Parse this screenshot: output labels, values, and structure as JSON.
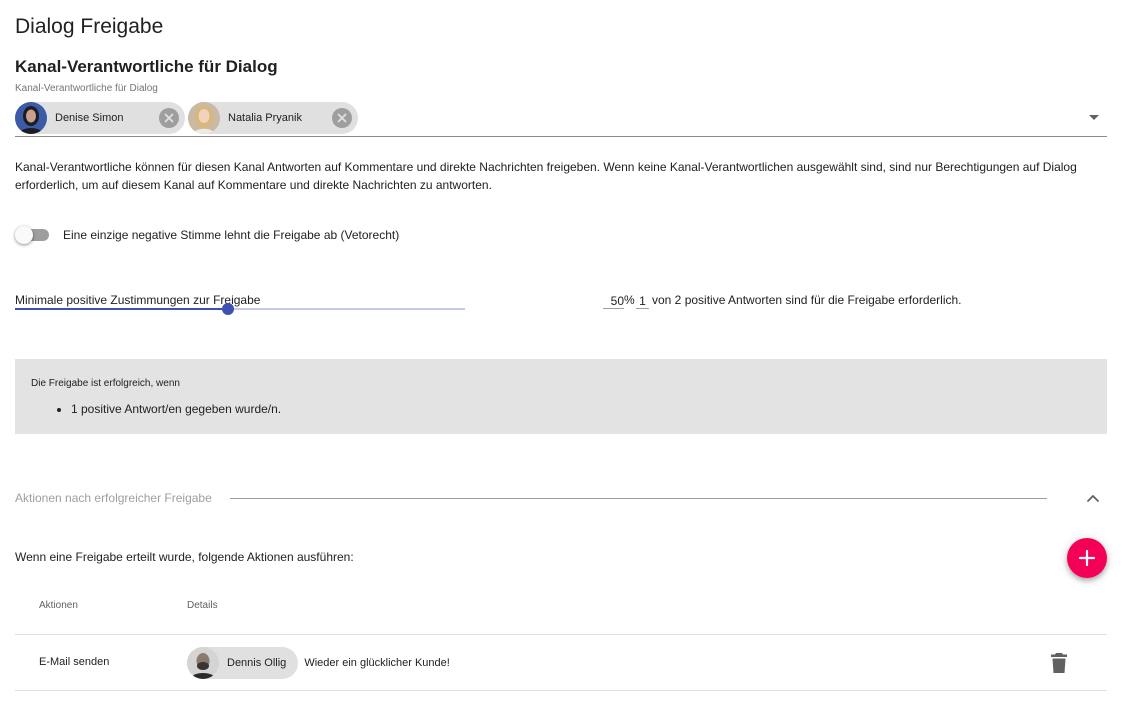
{
  "page": {
    "title": "Dialog Freigabe"
  },
  "responsibles": {
    "heading": "Kanal-Verantwortliche für Dialog",
    "field_label": "Kanal-Verantwortliche für Dialog",
    "chips": [
      {
        "name": "Denise Simon",
        "avatar_icon": "person-avatar"
      },
      {
        "name": "Natalia Pryanik",
        "avatar_icon": "person-avatar"
      }
    ],
    "help_text": "Kanal-Verantwortliche können für diesen Kanal Antworten auf Kommentare und direkte Nachrichten freigeben. Wenn keine Kanal-Verantwortlichen ausgewählt sind, sind nur Berechtigungen auf Dialog erforderlich, um auf diesem Kanal auf Kommentare und direkte Nachrichten zu antworten."
  },
  "veto": {
    "label": "Eine einzige negative Stimme lehnt die Freigabe ab (Vetorecht)",
    "enabled": false
  },
  "approval": {
    "slider_label": "Minimale positive Zustimmungen zur Freigabe",
    "slider_value_percent": 50,
    "percent_value": "50",
    "percent_sign": "%",
    "count_value": "1",
    "count_text": "von 2 positive Antworten sind für die Freigabe erforderlich."
  },
  "info": {
    "title": "Die Freigabe ist erfolgreich, wenn",
    "items": [
      "1 positive Antwort/en gegeben wurde/n."
    ]
  },
  "actions_section": {
    "divider_label": "Aktionen nach erfolgreicher Freigabe",
    "intro": "Wenn eine Freigabe erteilt wurde, folgende Aktionen ausführen:",
    "columns": {
      "actions": "Aktionen",
      "details": "Details"
    },
    "rows": [
      {
        "action": "E-Mail senden",
        "user": "Dennis Ollig",
        "message": "Wieder ein glücklicher Kunde!"
      }
    ]
  },
  "colors": {
    "primary": "#3f51b5",
    "accent": "#f50057",
    "info_background": "#e3e3e3",
    "chip_background": "#e0e0e0"
  }
}
